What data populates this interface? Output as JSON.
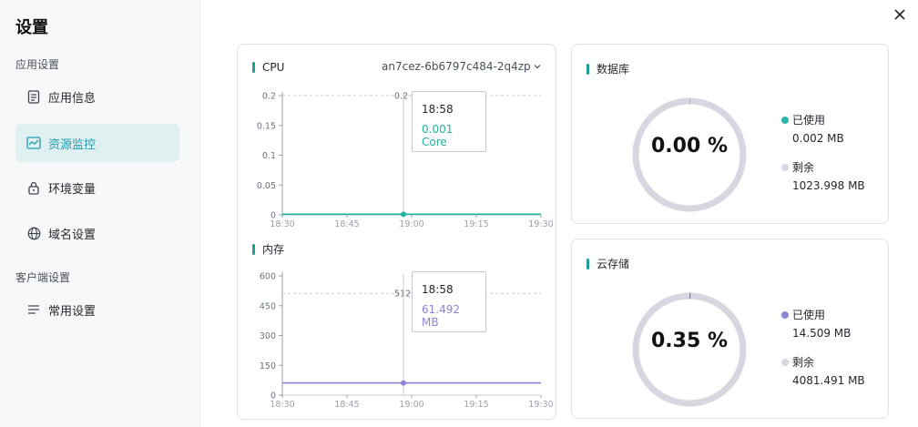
{
  "sidebar": {
    "title": "设置",
    "group1": "应用设置",
    "group2": "客户端设置",
    "items": [
      {
        "label": "应用信息"
      },
      {
        "label": "资源监控"
      },
      {
        "label": "环境变量"
      },
      {
        "label": "域名设置"
      },
      {
        "label": "常用设置"
      }
    ]
  },
  "cpu": {
    "title": "CPU",
    "pod": "an7cez-6b6797c484-2q4zp",
    "limit_label": "0.2 Core",
    "tooltip_time": "18:58",
    "tooltip_value": "0.001 Core",
    "color": "#1eb39e"
  },
  "memory": {
    "title": "内存",
    "limit_label": "512",
    "tooltip_time": "18:58",
    "tooltip_value": "61.492 MB",
    "color": "#8a84d6"
  },
  "database": {
    "title": "数据库",
    "percent": "0.00 %",
    "used_label": "已使用",
    "used_value": "0.002 MB",
    "free_label": "剩余",
    "free_value": "1023.998 MB",
    "used_color": "#2ab5ad"
  },
  "storage": {
    "title": "云存储",
    "percent": "0.35 %",
    "used_label": "已使用",
    "used_value": "14.509 MB",
    "free_label": "剩余",
    "free_value": "4081.491 MB",
    "used_color": "#8a84d6"
  },
  "chart_data": [
    {
      "type": "line",
      "title": "CPU",
      "x": [
        "18:30",
        "18:45",
        "19:00",
        "19:15",
        "19:30"
      ],
      "y_ticks": [
        "0",
        "0.05",
        "0.1",
        "0.15",
        "0.2"
      ],
      "ylim": [
        0,
        0.2
      ],
      "limit": 0.2,
      "series": [
        {
          "values": [
            0.001,
            0.001,
            0.001,
            0.001,
            0.001
          ]
        }
      ],
      "highlight": {
        "x": "18:58",
        "y": 0.001
      }
    },
    {
      "type": "line",
      "title": "内存",
      "x": [
        "18:30",
        "18:45",
        "19:00",
        "19:15",
        "19:30"
      ],
      "y_ticks": [
        "0",
        "150",
        "300",
        "450",
        "600"
      ],
      "ylim": [
        0,
        600
      ],
      "limit": 512,
      "series": [
        {
          "values": [
            61.492,
            61.492,
            61.492,
            61.492,
            61.492
          ]
        }
      ],
      "highlight": {
        "x": "18:58",
        "y": 61.492
      }
    },
    {
      "type": "pie",
      "title": "数据库",
      "slices": [
        {
          "label": "已使用",
          "value": 0.002
        },
        {
          "label": "剩余",
          "value": 1023.998
        }
      ]
    },
    {
      "type": "pie",
      "title": "云存储",
      "slices": [
        {
          "label": "已使用",
          "value": 14.509
        },
        {
          "label": "剩余",
          "value": 4081.491
        }
      ]
    }
  ]
}
